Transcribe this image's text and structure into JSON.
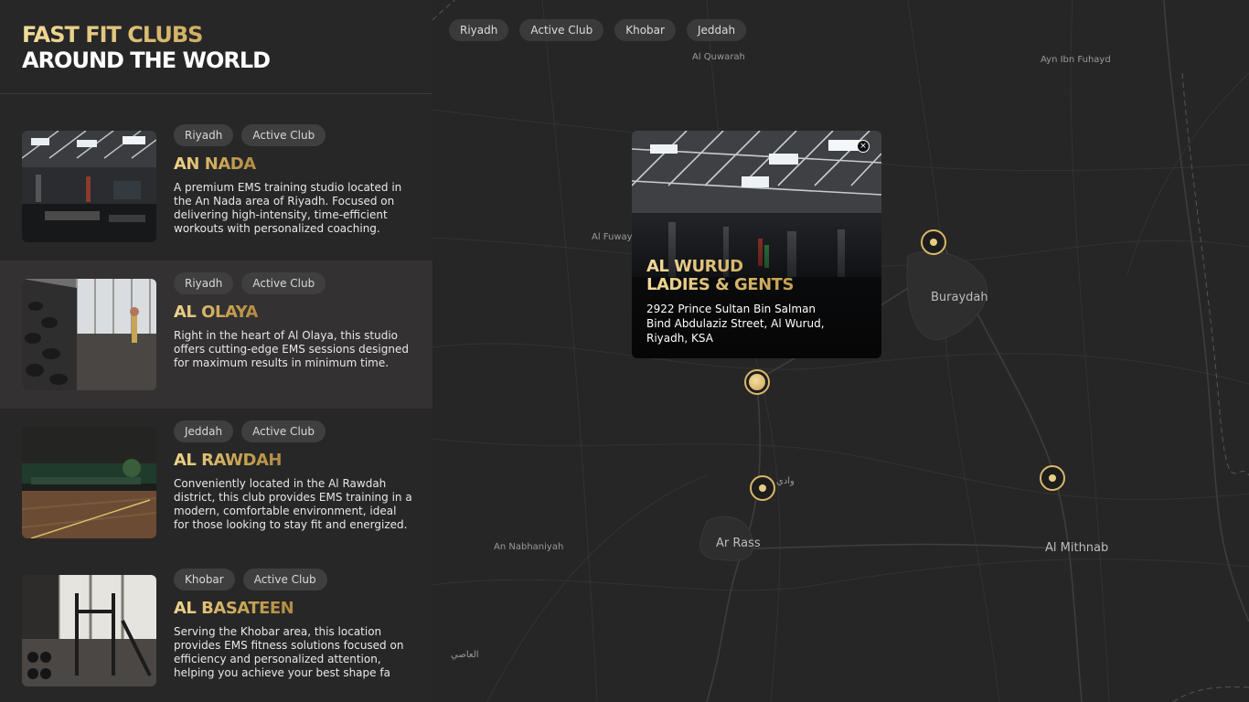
{
  "brand": {
    "line1": "FAST FIT CLUBS",
    "line2": "AROUND THE WORLD"
  },
  "clubs": [
    {
      "tags": [
        "Riyadh",
        "Active Club"
      ],
      "name": "AN NADA",
      "description": "A premium EMS training studio located in the An Nada area of Riyadh. Focused on delivering high-intensity, time-efficient workouts with personalized coaching."
    },
    {
      "tags": [
        "Riyadh",
        "Active Club"
      ],
      "name": "AL OLAYA",
      "description": "Right in the heart of Al Olaya, this studio offers cutting-edge EMS sessions designed for maximum results in minimum time."
    },
    {
      "tags": [
        "Jeddah",
        "Active Club"
      ],
      "name": "AL RAWDAH",
      "description": "Conveniently located in the Al Rawdah district, this club provides EMS training in a modern, comfortable environment, ideal for those looking to stay fit and energized."
    },
    {
      "tags": [
        "Khobar",
        "Active Club"
      ],
      "name": "AL BASATEEN",
      "description": "Serving the Khobar area, this location provides EMS fitness solutions focused on efficiency and personalized attention, helping you achieve your best shape fa"
    }
  ],
  "map": {
    "filters": [
      "Riyadh",
      "Active Club",
      "Khobar",
      "Jeddah"
    ],
    "places": {
      "al_quwarah": "Al Quwarah",
      "ayn_ibn_fuhayd": "Ayn Ibn Fuhayd",
      "al_fuwayliq": "Al Fuway",
      "buraydah": "Buraydah",
      "wadi": "وادي",
      "ar_rass": "Ar Rass",
      "an_nabhaniyah": "An Nabhaniyah",
      "al_mithnab": "Al Mithnab",
      "al_asi": "العاصي"
    },
    "popup": {
      "title_line1": "AL WURUD",
      "title_line2": "LADIES & GENTS",
      "address": "2922 Prince Sultan Bin Salman Bind Abdulaziz Street, Al Wurud, Riyadh, KSA",
      "close_icon": "×"
    }
  },
  "colors": {
    "gold_light": "#f3dc9a",
    "gold": "#c9a455",
    "panel": "#272727",
    "map_bg": "#262626"
  }
}
